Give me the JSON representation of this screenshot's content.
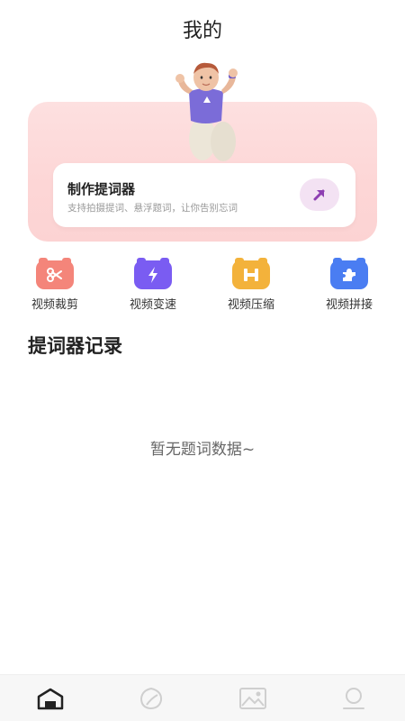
{
  "header": {
    "title": "我的"
  },
  "hero": {
    "card_title": "制作提词器",
    "card_subtitle": "支持拍摄提词、悬浮题词，让你告别忘词",
    "arrow_icon": "arrow-up-right-icon",
    "bg_color": "#fdd8d8",
    "accent_color": "#8e3fb2"
  },
  "tools": [
    {
      "label": "视频裁剪",
      "icon": "scissors-icon",
      "color": "#f46a5f"
    },
    {
      "label": "视频变速",
      "icon": "lightning-icon",
      "color": "#7a5cf2"
    },
    {
      "label": "视频压缩",
      "icon": "compress-icon",
      "color": "#f3b23b"
    },
    {
      "label": "视频拼接",
      "icon": "puzzle-icon",
      "color": "#4a7df2"
    }
  ],
  "records": {
    "title": "提词器记录",
    "empty_text": "暂无题词数据~"
  },
  "tabbar": [
    {
      "icon": "home-icon",
      "active": true
    },
    {
      "icon": "leaf-icon",
      "active": false
    },
    {
      "icon": "image-icon",
      "active": false
    },
    {
      "icon": "profile-icon",
      "active": false
    }
  ]
}
